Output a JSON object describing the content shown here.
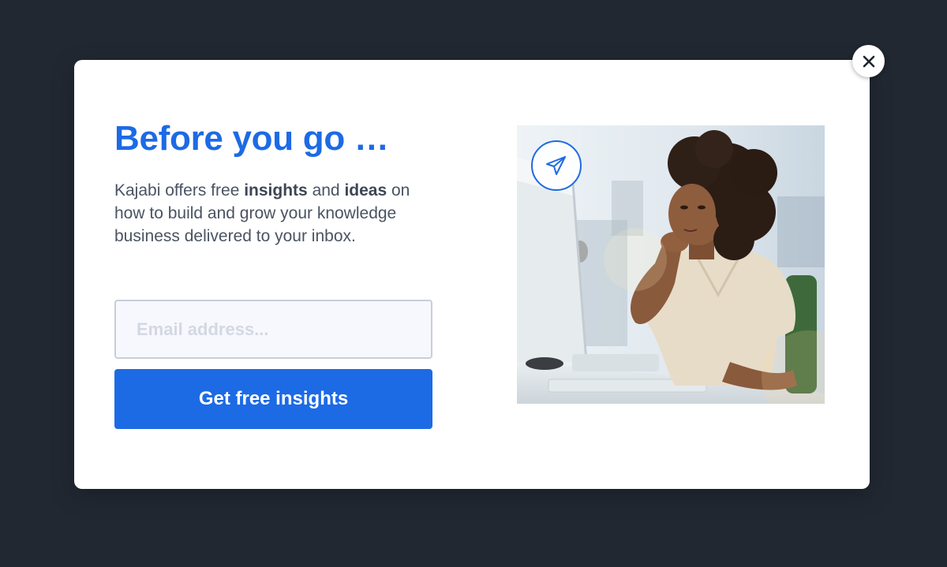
{
  "modal": {
    "title": "Before you go …",
    "description": {
      "part1": "Kajabi offers free ",
      "bold1": "insights",
      "part2": " and ",
      "bold2": "ideas",
      "part3": " on how to build and grow your knowledge business delivered to your inbox."
    },
    "email_placeholder": "Email address...",
    "submit_label": "Get free insights",
    "close_icon": "close-icon",
    "badge_icon": "paper-plane-icon"
  },
  "colors": {
    "backdrop": "#222832",
    "accent": "#1d6ae5",
    "text": "#4a5363"
  }
}
